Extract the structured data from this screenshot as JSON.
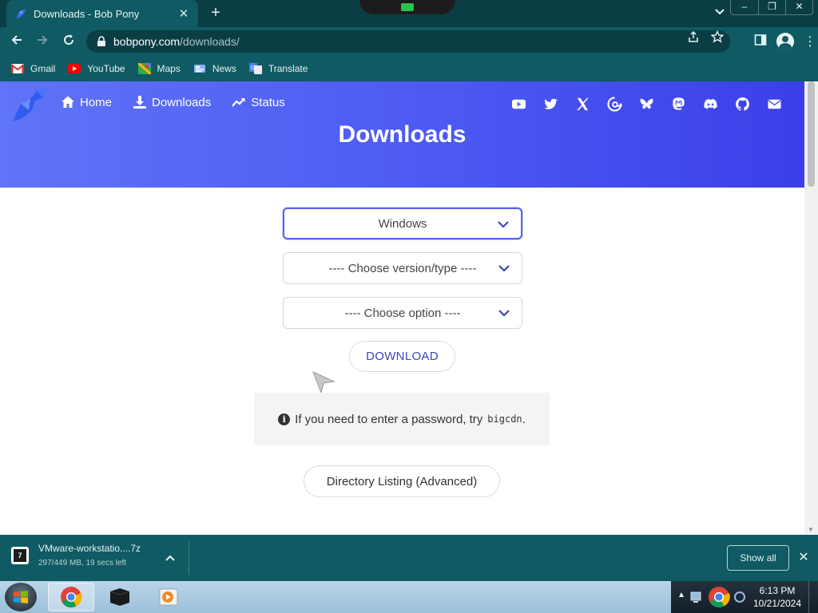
{
  "browser": {
    "tab_title": "Downloads - Bob Pony",
    "tab_close": "✕",
    "new_tab": "+",
    "url_host": "bobpony.com",
    "url_path": "/downloads/",
    "window_controls": [
      "–",
      "❐",
      "✕"
    ]
  },
  "bookmarks": [
    {
      "label": "Gmail",
      "icon": "gmail-icon"
    },
    {
      "label": "YouTube",
      "icon": "youtube-icon"
    },
    {
      "label": "Maps",
      "icon": "maps-icon"
    },
    {
      "label": "News",
      "icon": "news-icon"
    },
    {
      "label": "Translate",
      "icon": "translate-icon"
    }
  ],
  "site": {
    "nav": [
      {
        "label": "Home",
        "icon": "home-icon"
      },
      {
        "label": "Downloads",
        "icon": "download-icon"
      },
      {
        "label": "Status",
        "icon": "trend-icon"
      }
    ],
    "social_icons": [
      "youtube-icon",
      "twitter-icon",
      "x-icon",
      "threads-icon",
      "bluesky-icon",
      "mastodon-icon",
      "discord-icon",
      "github-icon",
      "email-icon"
    ],
    "page_title": "Downloads"
  },
  "form": {
    "os_select": "Windows",
    "version_select": "---- Choose version/type ----",
    "option_select": "---- Choose option ----",
    "download_button": "DOWNLOAD",
    "notice_text": "If you need to enter a password, try",
    "notice_code": "bigcdn",
    "notice_end": ".",
    "directory_button": "Directory Listing (Advanced)"
  },
  "download_shelf": {
    "file_name": "VMware-workstatio....7z",
    "progress_text": "297/449 MB, 19 secs left",
    "progress_fraction": 0.661,
    "show_all": "Show all",
    "close": "✕"
  },
  "taskbar": {
    "time": "6:13 PM",
    "date": "10/21/2024"
  },
  "colors": {
    "chrome_frame": "#0f5a63",
    "hero_start": "#5f74f7",
    "hero_end": "#3b3fe9",
    "accent": "#3d46b8"
  }
}
